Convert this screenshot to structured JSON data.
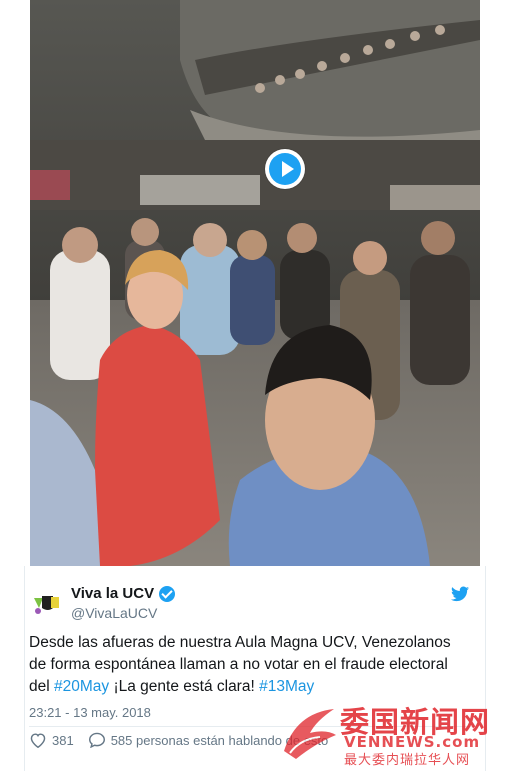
{
  "video": {
    "play_icon": "play-icon"
  },
  "tweet": {
    "display_name": "Viva la UCV",
    "handle": "@VivaLaUCV",
    "verified_icon": "verified-badge-icon",
    "brand_icon": "twitter-bird-icon",
    "text_part1": "Desde las afueras de nuestra Aula Magna UCV, Venezolanos de forma espontánea llaman a no votar en el fraude electoral del ",
    "hashtag1": "#20May",
    "text_part2": " ¡La gente está clara! ",
    "hashtag2": "#13May",
    "timestamp": "23:21 - 13 may. 2018",
    "likes_count": "381",
    "likes_icon": "heart-icon",
    "comments_icon": "speech-bubble-icon",
    "comments_text": "585 personas están hablando de esto",
    "accent_color": "#1da1f2",
    "hashtag_color": "#1b95e0"
  },
  "watermark": {
    "chinese_title": "委国新闻网",
    "site": "VENNEWS.com",
    "subtitle": "最大委内瑞拉华人网",
    "color": "#e0242a"
  }
}
